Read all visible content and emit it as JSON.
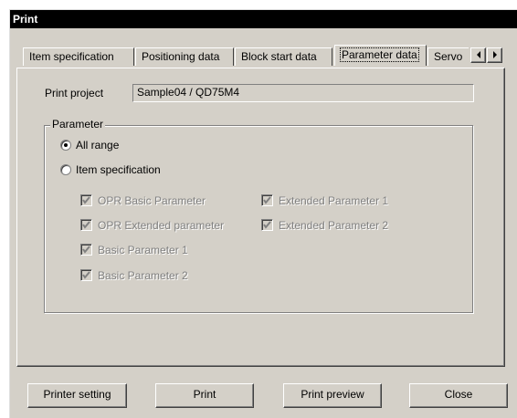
{
  "window": {
    "title": "Print"
  },
  "tabs": [
    {
      "label": "Item specification",
      "active": false
    },
    {
      "label": "Positioning data",
      "active": false
    },
    {
      "label": "Block start data",
      "active": false
    },
    {
      "label": "Parameter data",
      "active": true
    },
    {
      "label": "Servo",
      "active": false
    }
  ],
  "tab_scroll": {
    "left_icon": "arrow-left-icon",
    "right_icon": "arrow-right-icon"
  },
  "project": {
    "label": "Print project",
    "value": "Sample04 / QD75M4"
  },
  "parameter_group": {
    "title": "Parameter",
    "radios": [
      {
        "label": "All range",
        "selected": true
      },
      {
        "label": "Item specification",
        "selected": false
      }
    ],
    "checkboxes": [
      {
        "label": "OPR Basic Parameter",
        "checked": true,
        "enabled": false
      },
      {
        "label": "OPR Extended parameter",
        "checked": true,
        "enabled": false
      },
      {
        "label": "Basic Parameter 1",
        "checked": true,
        "enabled": false
      },
      {
        "label": "Basic Parameter 2",
        "checked": true,
        "enabled": false
      },
      {
        "label": "Extended Parameter 1",
        "checked": true,
        "enabled": false
      },
      {
        "label": "Extended Parameter 2",
        "checked": true,
        "enabled": false
      }
    ]
  },
  "buttons": {
    "printer_setting": "Printer setting",
    "print": "Print",
    "print_preview": "Print preview",
    "close": "Close"
  },
  "colors": {
    "face": "#d4d0c8",
    "titlebar": "#000000",
    "disabled_text": "#808080"
  }
}
